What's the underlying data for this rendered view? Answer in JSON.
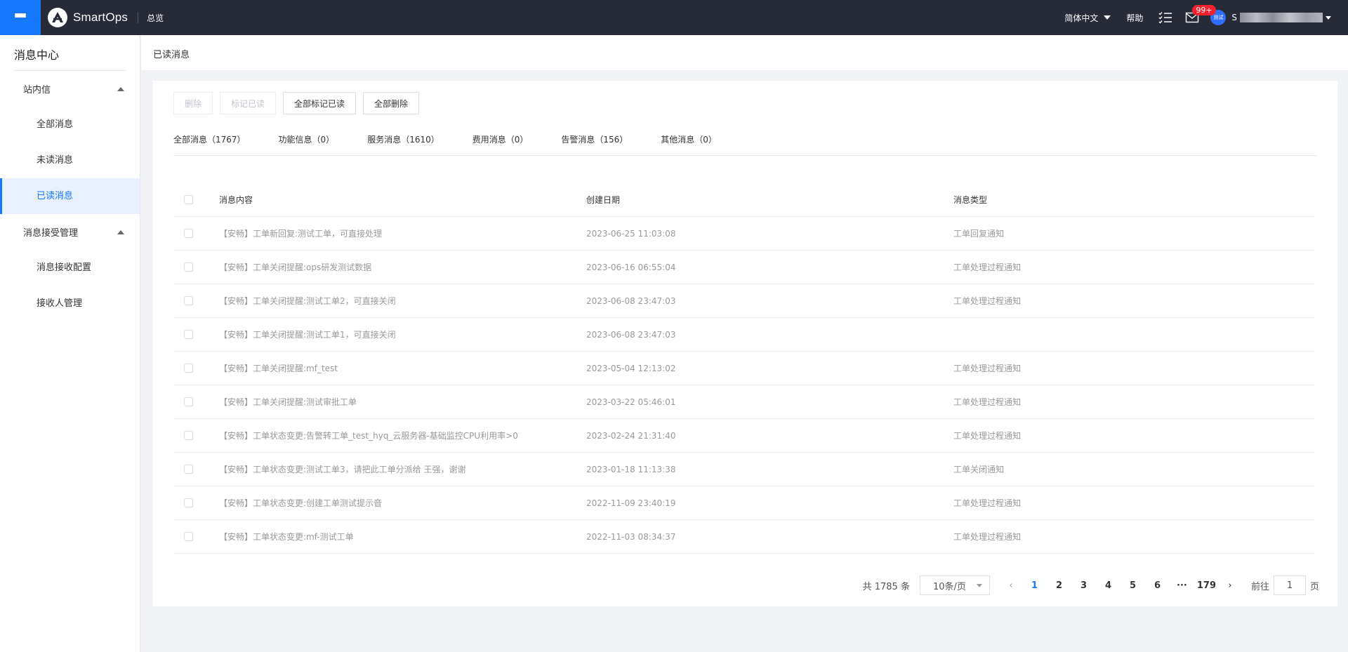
{
  "topbar": {
    "brand": "SmartOps",
    "overview": "总览",
    "language": "简体中文",
    "help": "帮助",
    "mail_badge": "99+",
    "avatar_text": "测试",
    "user_initial": "S"
  },
  "sidebar": {
    "title": "消息中心",
    "groups": [
      {
        "label": "站内信",
        "items": [
          "全部消息",
          "未读消息",
          "已读消息"
        ]
      },
      {
        "label": "消息接受管理",
        "items": [
          "消息接收配置",
          "接收人管理"
        ]
      }
    ]
  },
  "breadcrumb": "已读消息",
  "toolbar": {
    "delete": "删除",
    "mark_read": "标记已读",
    "mark_all_read": "全部标记已读",
    "delete_all": "全部删除"
  },
  "tabs": [
    "全部消息（1767）",
    "功能信息（0）",
    "服务消息（1610）",
    "费用消息（0）",
    "告警消息（156）",
    "其他消息（0）"
  ],
  "table": {
    "headers": {
      "content": "消息内容",
      "date": "创建日期",
      "type": "消息类型"
    },
    "rows": [
      {
        "content": "【安畅】工单新回复:测试工单，可直接处理",
        "date": "2023-06-25 11:03:08",
        "type": "工单回复通知"
      },
      {
        "content": "【安畅】工单关闭提醒:ops研发测试数据",
        "date": "2023-06-16 06:55:04",
        "type": "工单处理过程通知"
      },
      {
        "content": "【安畅】工单关闭提醒:测试工单2，可直接关闭",
        "date": "2023-06-08 23:47:03",
        "type": "工单处理过程通知"
      },
      {
        "content": "【安畅】工单关闭提醒:测试工单1，可直接关闭",
        "date": "2023-06-08 23:47:03",
        "type": ""
      },
      {
        "content": "【安畅】工单关闭提醒:mf_test",
        "date": "2023-05-04 12:13:02",
        "type": "工单处理过程通知"
      },
      {
        "content": "【安畅】工单关闭提醒:测试审批工单",
        "date": "2023-03-22 05:46:01",
        "type": "工单处理过程通知"
      },
      {
        "content": "【安畅】工单状态变更:告警转工单_test_hyq_云服务器-基础监控CPU利用率>0",
        "date": "2023-02-24 21:31:40",
        "type": "工单处理过程通知"
      },
      {
        "content": "【安畅】工单状态变更:测试工单3，请把此工单分派给 王强，谢谢",
        "date": "2023-01-18 11:13:38",
        "type": "工单关闭通知"
      },
      {
        "content": "【安畅】工单状态变更:创建工单测试提示音",
        "date": "2022-11-09 23:40:19",
        "type": "工单处理过程通知"
      },
      {
        "content": "【安畅】工单状态变更:mf-测试工单",
        "date": "2022-11-03 08:34:37",
        "type": "工单处理过程通知"
      }
    ]
  },
  "pager": {
    "total": "共 1785 条",
    "page_size": "10条/页",
    "pages": [
      "1",
      "2",
      "3",
      "4",
      "5",
      "6",
      "···",
      "179"
    ],
    "current": "1",
    "goto_prefix": "前往",
    "goto_value": "1",
    "goto_suffix": "页"
  }
}
